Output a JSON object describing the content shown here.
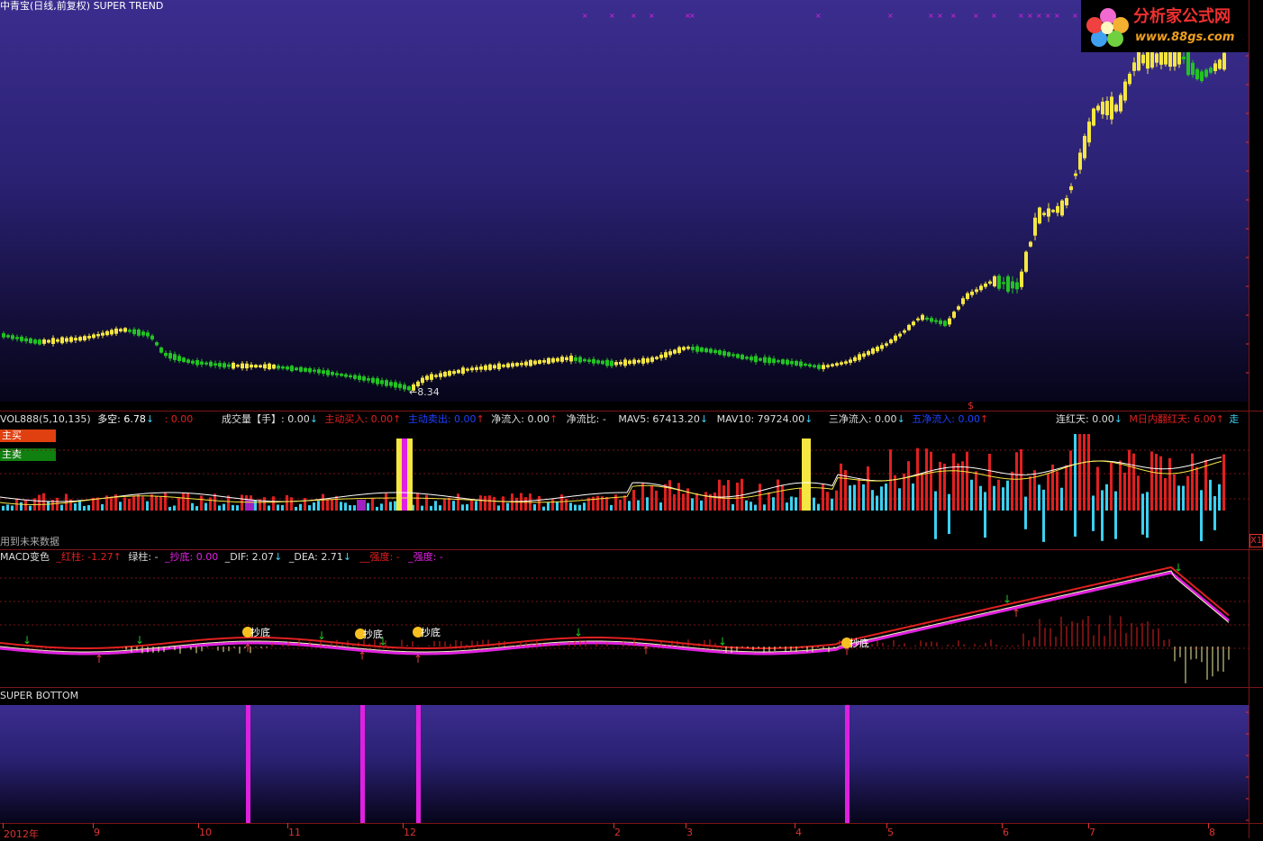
{
  "main": {
    "title": "中青宝(日线,前复权) SUPER TREND",
    "low_label": "←8.34",
    "marker_s": "$"
  },
  "logo": {
    "text": "分析家公式网",
    "url": "www.88gs.com"
  },
  "vol": {
    "name": "VOL888(5,10,135)",
    "duokong": "多空: 6.78",
    "duokong_val": ": 0.00",
    "chengjiao": "成交量【手】: 0.00",
    "zhudong_buy": "主动买入: 0.00",
    "zhudong_sell": "主动卖出: 0.00",
    "jingliuru": "净流入: 0.00",
    "jingliubi": "净流比: -",
    "mav5": "MAV5: 67413.20",
    "mav10": "MAV10: 79724.00",
    "sanjing": "三净流入: 0.00",
    "wujing": "五净流入: 0.00",
    "lianhong": "连红天: 0.00",
    "rinei": "M日内翻红天: 6.00",
    "zou": "走",
    "btn_buy": "主买",
    "btn_sell": "主卖",
    "future_note": "用到未来数据",
    "scale_mark": "X1"
  },
  "macd": {
    "name": "MACD变色",
    "hongzhu": "_红柱: -1.27",
    "lvzhu": "绿柱: -",
    "chaodi": "_抄底: 0.00",
    "dif": "_DIF: 2.07",
    "dea": "_DEA: 2.71",
    "qiangdu1": "__强度: -",
    "qiangdu2": "_强度: -",
    "chaodi_tag": "抄底"
  },
  "bottom": {
    "name": "SUPER BOTTOM"
  },
  "dates": [
    {
      "label": "2012年"
    },
    {
      "label": "9"
    },
    {
      "label": "10"
    },
    {
      "label": "11"
    },
    {
      "label": "12"
    },
    {
      "label": "2"
    },
    {
      "label": "3"
    },
    {
      "label": "4"
    },
    {
      "label": "5"
    },
    {
      "label": "6"
    },
    {
      "label": "7"
    },
    {
      "label": "8"
    }
  ],
  "colors": {
    "up": "#f5e642",
    "down": "#22c322",
    "pink": "#e020e0",
    "red": "#e02020",
    "cyan": "#3cd0f0"
  }
}
